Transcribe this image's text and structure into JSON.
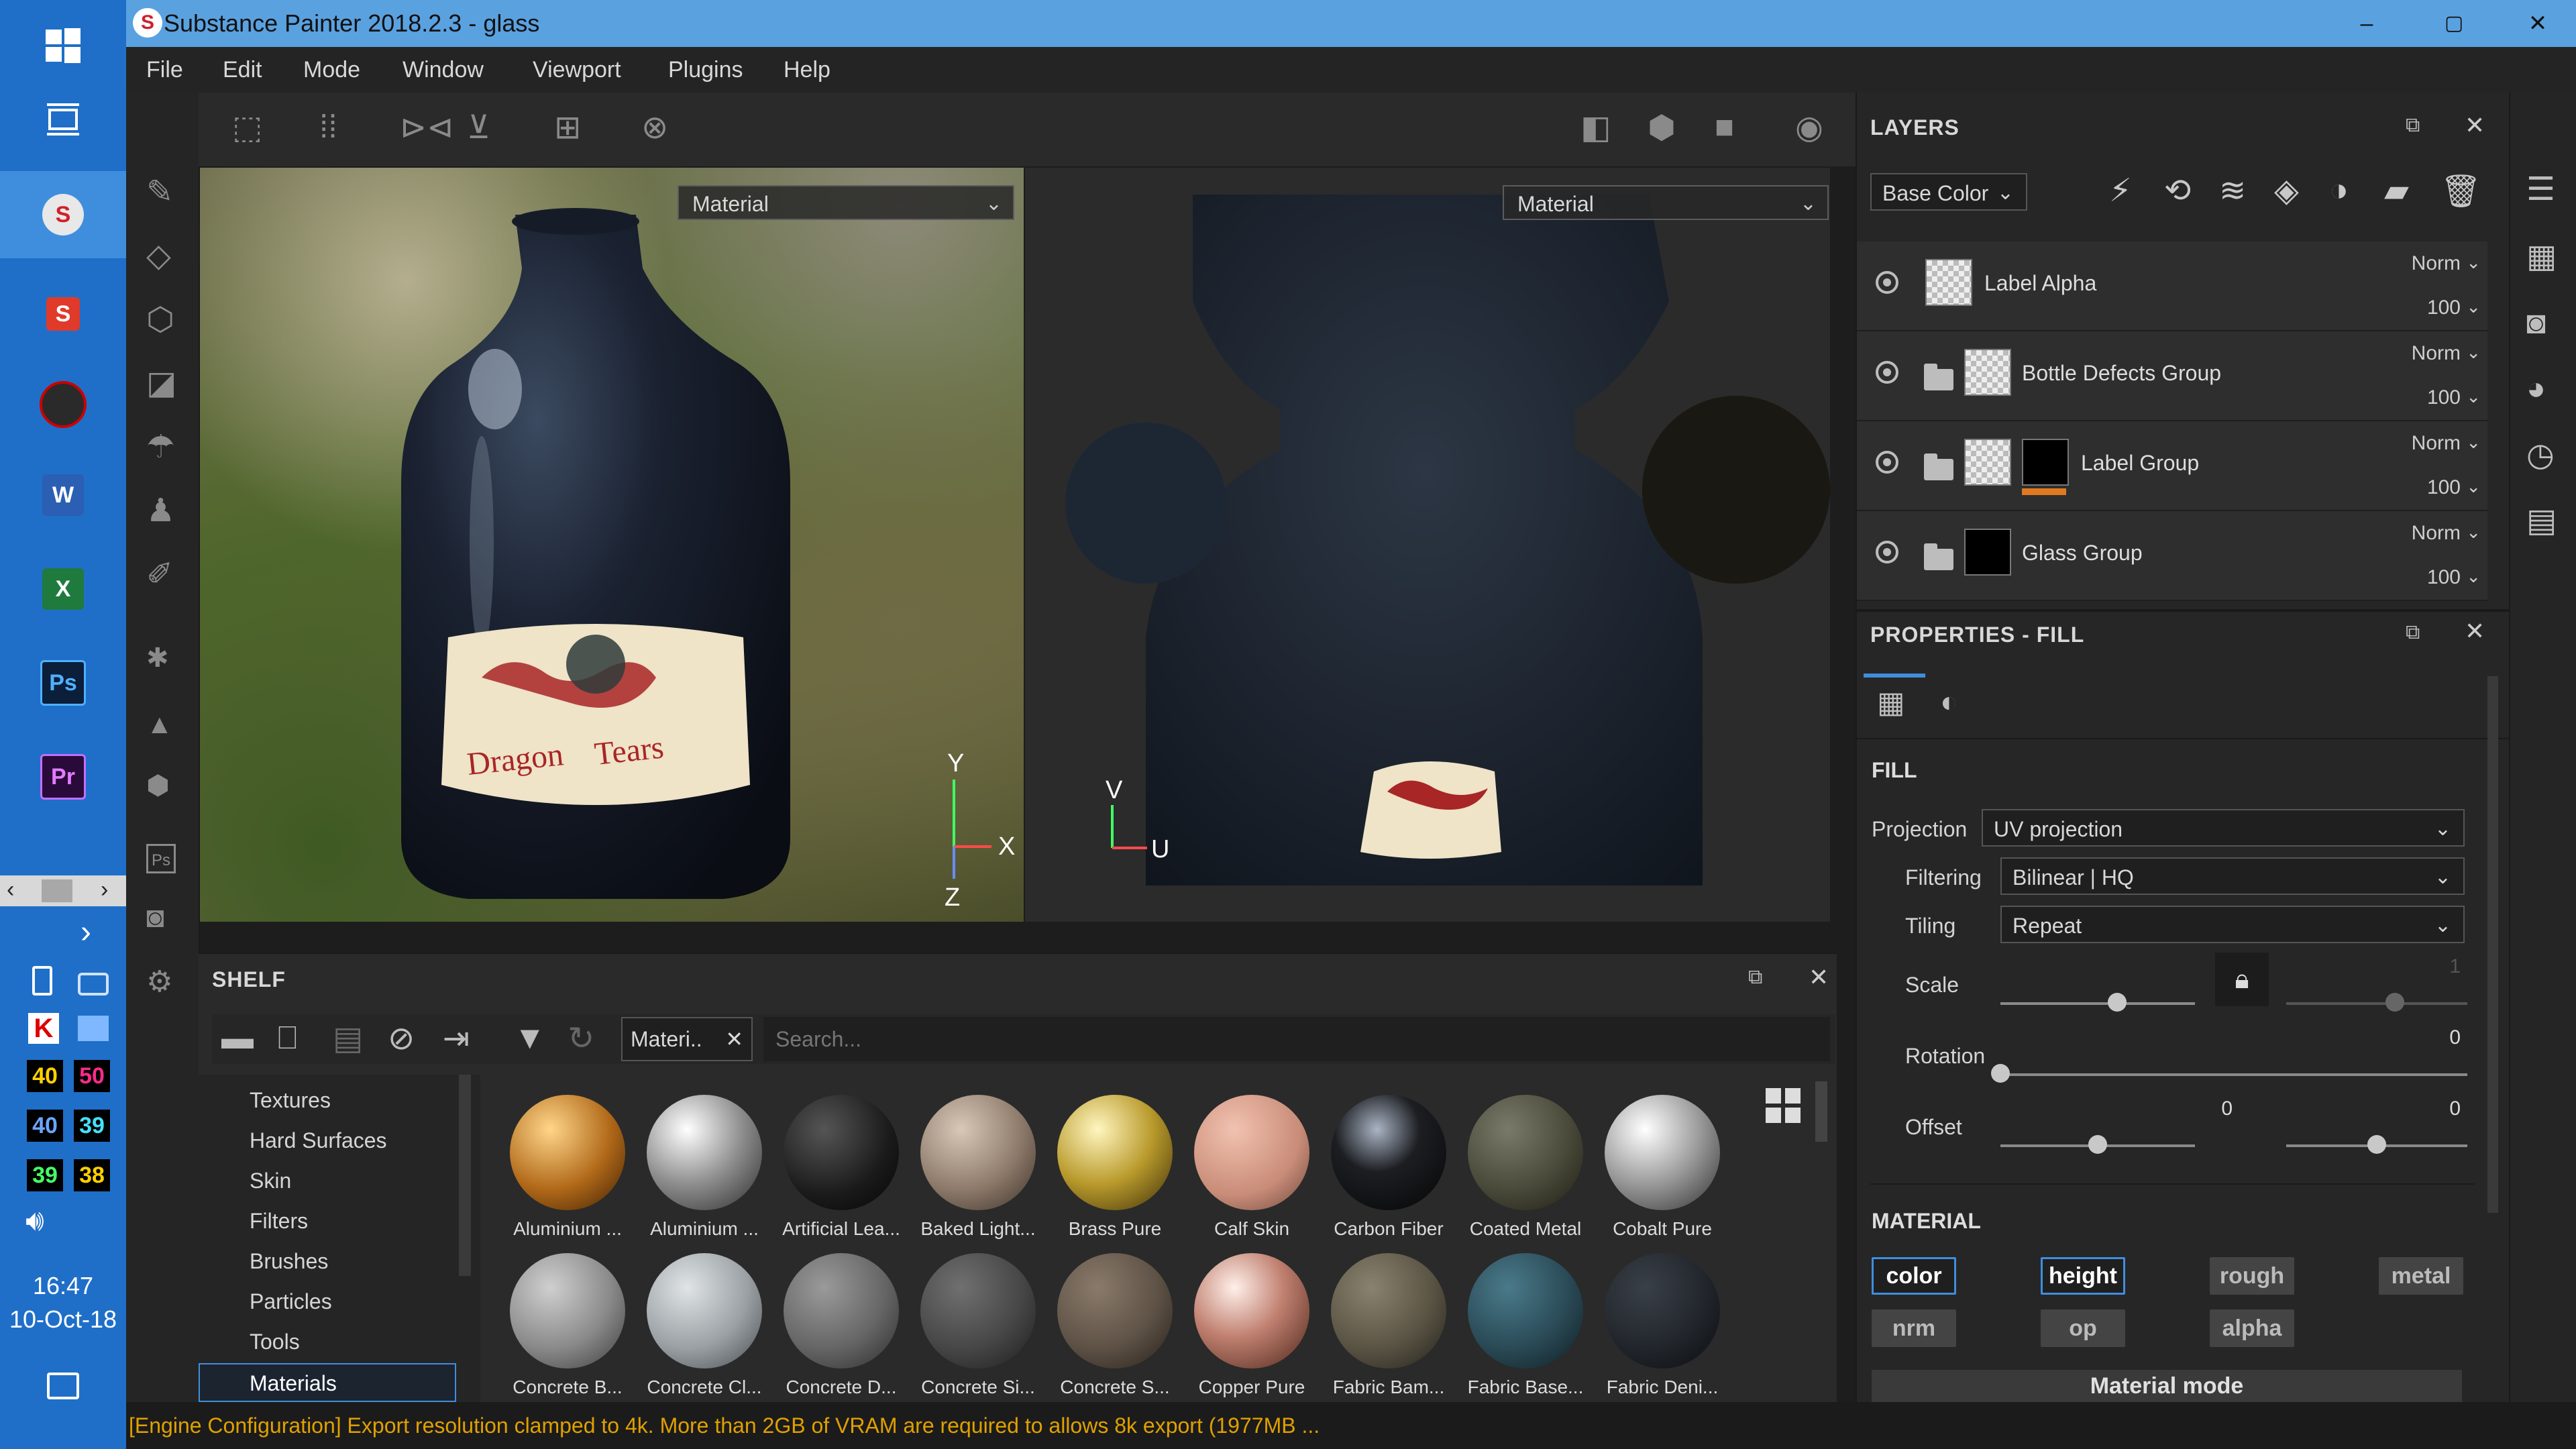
{
  "window": {
    "title": "Substance Painter 2018.2.3 - glass",
    "min": "–",
    "max": "▢",
    "close": "✕"
  },
  "menu": [
    "File",
    "Edit",
    "Mode",
    "Window",
    "Viewport",
    "Plugins",
    "Help"
  ],
  "viewport": {
    "left_mode": "Material",
    "right_mode": "Material",
    "label_line1": "Dragon",
    "label_line2": "Tears",
    "axes3d": {
      "y": "Y",
      "x": "X",
      "z": "Z"
    },
    "axes2d": {
      "v": "V",
      "u": "U"
    }
  },
  "layers": {
    "title": "LAYERS",
    "channel": "Base Color",
    "items": [
      {
        "name": "Label Alpha",
        "blend": "Norm",
        "opacity": "100"
      },
      {
        "name": "Bottle Defects Group",
        "blend": "Norm",
        "opacity": "100"
      },
      {
        "name": "Label Group",
        "blend": "Norm",
        "opacity": "100"
      },
      {
        "name": "Glass Group",
        "blend": "Norm",
        "opacity": "100"
      }
    ]
  },
  "properties": {
    "title": "PROPERTIES - FILL",
    "fill_heading": "FILL",
    "projection_label": "Projection",
    "projection_value": "UV projection",
    "filtering_label": "Filtering",
    "filtering_value": "Bilinear | HQ",
    "tiling_label": "Tiling",
    "tiling_value": "Repeat",
    "scale_label": "Scale",
    "scale_value": "1",
    "scale_value_locked": "1",
    "scale_level": 0.6,
    "rotation_label": "Rotation",
    "rotation_value": "0",
    "rotation_level": 0.0,
    "offset_label": "Offset",
    "offset_u": "0",
    "offset_v": "0",
    "offset_level": 0.5,
    "material_heading": "MATERIAL",
    "channels": [
      {
        "label": "color",
        "on": true
      },
      {
        "label": "height",
        "on": true
      },
      {
        "label": "rough",
        "on": false
      },
      {
        "label": "metal",
        "on": false
      },
      {
        "label": "nrm",
        "on": false
      },
      {
        "label": "op",
        "on": false
      },
      {
        "label": "alpha",
        "on": false
      }
    ],
    "material_mode": "Material mode"
  },
  "shelf": {
    "title": "SHELF",
    "filter_tag": "Materi..",
    "search_placeholder": "Search...",
    "categories": [
      "Textures",
      "Hard Surfaces",
      "Skin",
      "Filters",
      "Brushes",
      "Particles",
      "Tools",
      "Materials"
    ],
    "selected_category": "Materials",
    "materials_row1": [
      "Aluminium ...",
      "Aluminium ...",
      "Artificial Lea...",
      "Baked Light...",
      "Brass Pure",
      "Calf Skin",
      "Carbon Fiber",
      "Coated Metal",
      "Cobalt Pure"
    ],
    "materials_row2": [
      "Concrete B...",
      "Concrete Cl...",
      "Concrete D...",
      "Concrete Si...",
      "Concrete S...",
      "Copper Pure",
      "Fabric Bam...",
      "Fabric Base...",
      "Fabric Deni..."
    ]
  },
  "taskbar": {
    "badges": [
      "40",
      "50",
      "40",
      "39",
      "39",
      "38"
    ],
    "time": "16:47",
    "date": "10-Oct-18",
    "apps": [
      "W",
      "X",
      "Ps",
      "Pr"
    ]
  },
  "status": "[Engine Configuration] Export resolution clamped to 4k. More than 2GB of VRAM are required to allows 8k export (1977MB ..."
}
